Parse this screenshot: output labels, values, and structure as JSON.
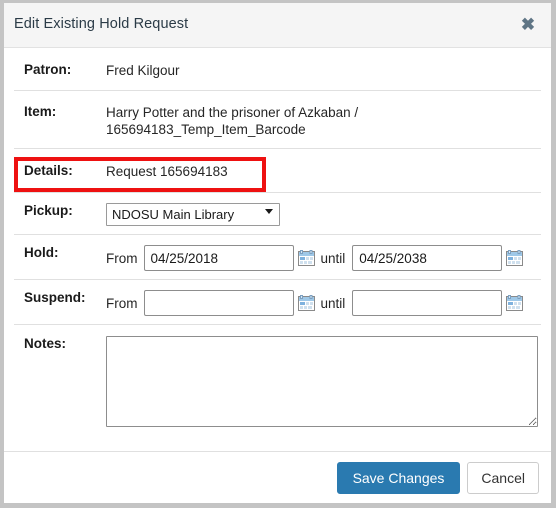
{
  "window": {
    "title": "Edit Existing Hold Request",
    "close_icon": "close-icon",
    "close_glyph": "✖"
  },
  "form": {
    "rows": [
      {
        "label": "Patron:",
        "value": "Fred Kilgour"
      },
      {
        "label": "Item:",
        "value_line1": "Harry Potter and the prisoner of Azkaban /",
        "value_line2": "165694183_Temp_Item_Barcode"
      },
      {
        "label": "Details:",
        "value": "Request 165694183"
      },
      {
        "label": "Pickup:"
      },
      {
        "label": "Hold:"
      },
      {
        "label": "Suspend:"
      },
      {
        "label": "Notes:"
      }
    ],
    "patron": {
      "label": "Patron:",
      "value": "Fred Kilgour"
    },
    "item": {
      "label": "Item:",
      "line1": "Harry Potter and the prisoner of Azkaban /",
      "line2": "165694183_Temp_Item_Barcode"
    },
    "details": {
      "label": "Details:",
      "value": "Request 165694183"
    },
    "pickup": {
      "label": "Pickup:",
      "selected": "NDOSU Main Library",
      "options": [
        "NDOSU Main Library"
      ],
      "arrow_icon": "chevron-down-icon"
    },
    "hold": {
      "label": "Hold:",
      "from_label": "From",
      "from_value": "04/25/2018",
      "until_label": "until",
      "until_value": "04/25/2038",
      "calendar_icon": "calendar-icon"
    },
    "suspend": {
      "label": "Suspend:",
      "from_label": "From",
      "from_value": "",
      "until_label": "until",
      "until_value": "",
      "calendar_icon": "calendar-icon"
    },
    "notes": {
      "label": "Notes:",
      "value": "",
      "placeholder": ""
    }
  },
  "footer": {
    "save_label": "Save Changes",
    "cancel_label": "Cancel"
  },
  "colors": {
    "primary_button": "#2a7ab0",
    "annotation": "#ee1111",
    "header_background": "#f5f5f5",
    "window_border": "#c4c4c4",
    "title_text": "#2b3b47"
  }
}
